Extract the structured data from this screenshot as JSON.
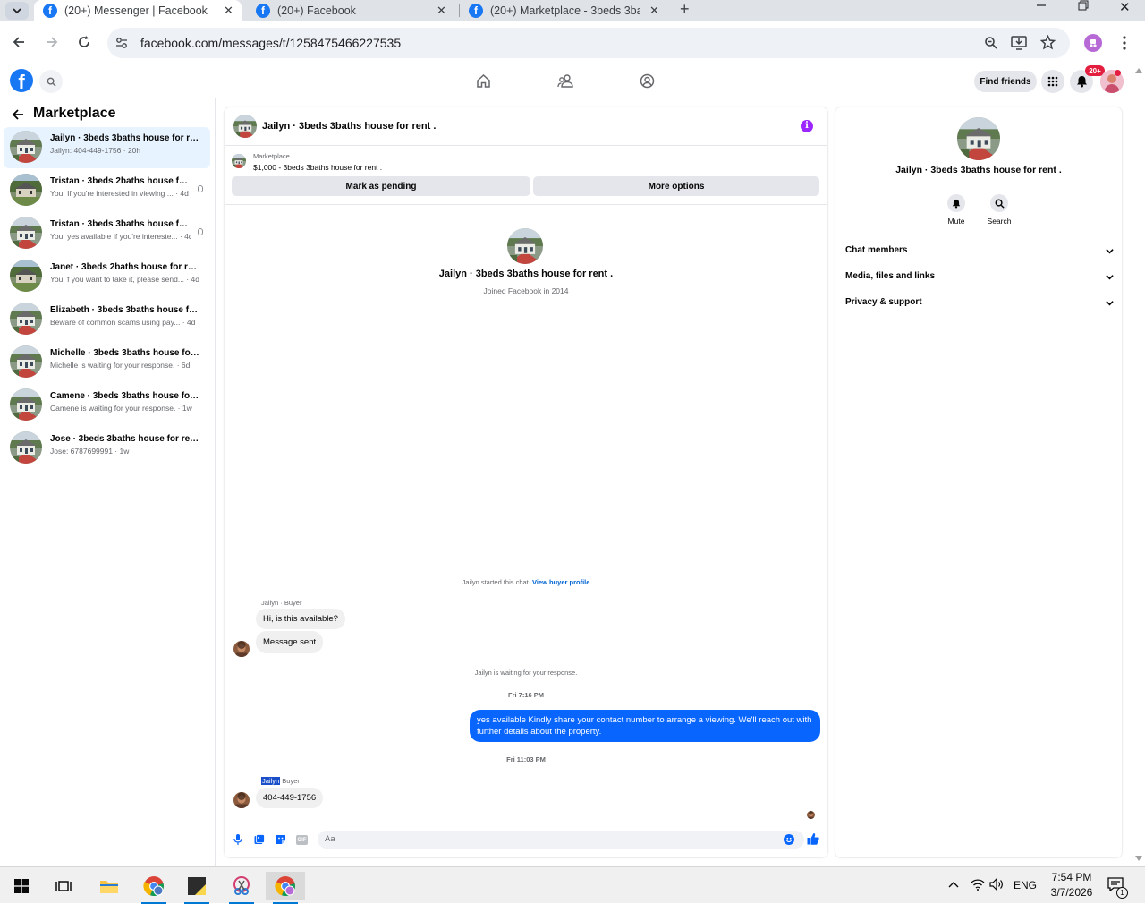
{
  "browser": {
    "tabs": [
      {
        "title": "(20+) Messenger | Facebook"
      },
      {
        "title": "(20+) Facebook"
      },
      {
        "title": "(20+) Marketplace - 3beds 3baths"
      }
    ],
    "url": "facebook.com/messages/t/1258475466227535"
  },
  "header": {
    "find_friends": "Find friends",
    "notif_badge": "20+"
  },
  "sidebar": {
    "title": "Marketplace",
    "threads": [
      {
        "title": "Jailyn · 3beds 3baths house for ren...",
        "preview": "Jailyn: 404-449-1756 · 20h"
      },
      {
        "title": "Tristan · 3beds 2baths house for...",
        "preview": "You: If you're interested in viewing ... · 4d"
      },
      {
        "title": "Tristan · 3beds 3baths house for...",
        "preview": "You: yes available If you're intereste... · 4d"
      },
      {
        "title": "Janet · 3beds 2baths house for rent .",
        "preview": "You: f you want to take it, please send... · 4d"
      },
      {
        "title": "Elizabeth · 3beds 3baths house for...",
        "preview": "Beware of common scams using pay... · 4d"
      },
      {
        "title": "Michelle · 3beds 3baths house for ...",
        "preview": "Michelle is waiting for your response. · 6d"
      },
      {
        "title": "Camene · 3beds 3baths house for ...",
        "preview": "Camene is waiting for your response. · 1w"
      },
      {
        "title": "Jose · 3beds 3baths house for rent .",
        "preview": "Jose: 6787699991 · 1w"
      }
    ]
  },
  "chat": {
    "header_title": "Jailyn · 3beds 3baths house for rent .",
    "listing_label": "Marketplace",
    "listing_price": "$1,000 - 3beds 3baths house for rent .",
    "mark_pending": "Mark as pending",
    "more_options": "More options",
    "profile_name": "Jailyn · 3beds 3baths house for rent .",
    "profile_joined": "Joined Facebook in 2014",
    "started_text": "Jailyn started this chat.",
    "view_buyer": "View buyer profile",
    "sender1_name": "Jailyn",
    "sender1_role": "· Buyer",
    "msg1": "Hi, is this available?",
    "msg2": "Message sent",
    "waiting_text": "Jailyn is waiting for your response.",
    "time1": "Fri 7:16 PM",
    "outgoing": "yes available Kindly share your contact number to arrange a viewing. We'll reach out with further details about the property.",
    "time2": "Fri 11:03 PM",
    "sender2_name": "Jailyn",
    "sender2_role": "Buyer",
    "msg3": "404-449-1756",
    "composer_placeholder": "Aa"
  },
  "info": {
    "name": "Jailyn · 3beds 3baths house for rent .",
    "mute": "Mute",
    "search": "Search",
    "sections": [
      "Chat members",
      "Media, files and links",
      "Privacy & support"
    ]
  },
  "taskbar": {
    "lang": "ENG",
    "time": "7:54 PM",
    "date": "3/7/2026",
    "notif": "1"
  },
  "colors": {
    "brand": "#1877f2",
    "outgoing_bubble": "#0866ff",
    "info_purple": "#9c27ff"
  }
}
